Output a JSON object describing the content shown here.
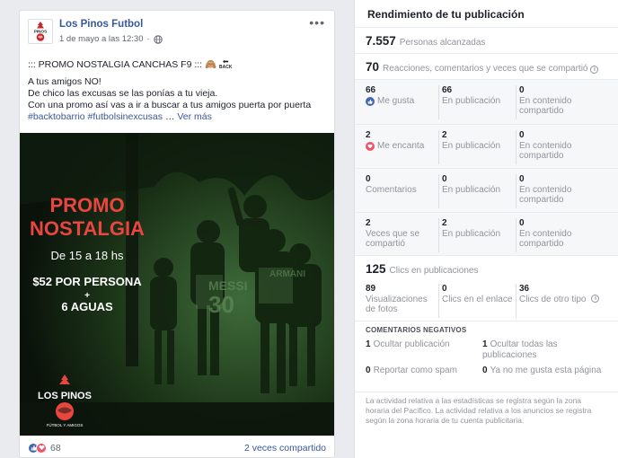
{
  "post": {
    "page_name": "Los Pinos Futbol",
    "date": "1 de mayo a las 12:30",
    "more": "•••",
    "line1": "::: PROMO NOSTALGIA CANCHAS F9 ::: ",
    "line1_emoji": "🙈",
    "line1_back": "BACK",
    "line2": "A tus amigos NO!",
    "line3": "De chico las excusas se las ponías a tu vieja.",
    "line4": "Con una promo así vas a ir a buscar a tus amigos puerta por puerta",
    "hashtag1": "#backtobarrio",
    "hashtag2": "#futbolsinexcusas",
    "see_more": "Ver más",
    "image": {
      "title1": "PROMO",
      "title2": "NOSTALGIA",
      "schedule": "De 15 a 18 hs",
      "price": "$52 POR PERSONA",
      "plus": "+",
      "extra": "6 AGUAS",
      "logo_text": "LOS PINOS",
      "logo_sub": "FÚTBOL Y AMIGOS",
      "shirt1": "MESSI",
      "shirt_num": "30",
      "shirt2": "ARMANI"
    },
    "reactions_count": "68",
    "shares": "2 veces compartido"
  },
  "insights": {
    "title": "Rendimiento de tu publicación",
    "reach_value": "7.557",
    "reach_label": "Personas alcanzadas",
    "engage_value": "70",
    "engage_label": "Reacciones, comentarios y veces que se compartió",
    "info": "i",
    "rows": [
      {
        "a_num": "66",
        "a_lbl": "Me gusta",
        "b_num": "66",
        "b_lbl": "En publicación",
        "c_num": "0",
        "c_lbl": "En contenido compartido"
      },
      {
        "a_num": "2",
        "a_lbl": "Me encanta",
        "b_num": "2",
        "b_lbl": "En publicación",
        "c_num": "0",
        "c_lbl": "En contenido compartido"
      },
      {
        "a_num": "0",
        "a_lbl": "Comentarios",
        "b_num": "0",
        "b_lbl": "En publicación",
        "c_num": "0",
        "c_lbl": "En contenido compartido"
      },
      {
        "a_num": "2",
        "a_lbl": "Veces que se compartió",
        "b_num": "2",
        "b_lbl": "En publicación",
        "c_num": "0",
        "c_lbl": "En contenido compartido"
      }
    ],
    "clicks_value": "125",
    "clicks_label": "Clics en publicaciones",
    "clicks": [
      {
        "num": "89",
        "lbl": "Visualizaciones de fotos"
      },
      {
        "num": "0",
        "lbl": "Clics en el enlace"
      },
      {
        "num": "36",
        "lbl": "Clics de otro tipo"
      }
    ],
    "negative_title": "COMENTARIOS NEGATIVOS",
    "negative": [
      {
        "num": "1",
        "lbl": "Ocultar publicación"
      },
      {
        "num": "1",
        "lbl": "Ocultar todas las publicaciones"
      },
      {
        "num": "0",
        "lbl": "Reportar como spam"
      },
      {
        "num": "0",
        "lbl": "Ya no me gusta esta página"
      }
    ],
    "disclaimer": "La actividad relativa a las estadísticas se registra según la zona horaria del Pacífico. La actividad relativa a los anuncios se registra según la zona horaria de tu cuenta publicitaria."
  },
  "colors": {
    "link": "#385898",
    "like": "#4267b2",
    "love": "#f25268",
    "promo_red": "#e8463f"
  }
}
